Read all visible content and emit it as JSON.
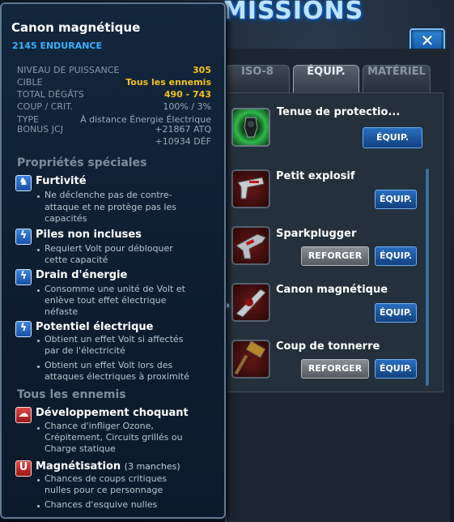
{
  "header": {
    "title": "MISSIONS",
    "close_label": "✕"
  },
  "tabs": [
    {
      "label": "ISO-8"
    },
    {
      "label": "ÉQUIP."
    },
    {
      "label": "MATÉRIEL"
    }
  ],
  "equipment": {
    "items": [
      {
        "name": "Tenue de protectio...",
        "equip_label": "ÉQUIP."
      },
      {
        "name": "Petit explosif",
        "equip_label": "ÉQUIP."
      },
      {
        "name": "Sparkplugger",
        "reforge_label": "REFORGER",
        "equip_label": "ÉQUIP."
      },
      {
        "name": "Canon magnétique",
        "equip_label": "ÉQUIP."
      },
      {
        "name": "Coup de tonnerre",
        "reforge_label": "REFORGER",
        "equip_label": "ÉQUIP."
      }
    ]
  },
  "tooltip": {
    "title": "Canon magnétique",
    "endurance": "2145 ENDURANCE",
    "stats": {
      "power_label": "NIVEAU DE PUISSANCE",
      "power_value": "305",
      "target_label": "CIBLE",
      "target_value": "Tous les ennemis",
      "damage_label": "TOTAL DÉGÂTS",
      "damage_value": "490 - 743",
      "crit_label": "COUP / CRIT.",
      "crit_value": "100% / 3%",
      "type_label": "TYPE",
      "type_value": "À distance Énergie Électrique",
      "bonus_label": "BONUS JCJ",
      "bonus_value_1": "+21867 ATQ",
      "bonus_value_2": "+10934 DÉF"
    },
    "special_header": "Propriétés spéciales",
    "properties": [
      {
        "title": "Furtivité",
        "icon": "stealth-icon",
        "desc": [
          "Ne déclenche pas de contre-",
          "attaque et ne protège pas les",
          "capacités"
        ]
      },
      {
        "title": "Piles non incluses",
        "icon": "lightning-icon",
        "desc": [
          "Requiert Volt pour débloquer",
          "cette capacité"
        ]
      },
      {
        "title": "Drain d'énergie",
        "icon": "lightning-icon",
        "desc": [
          "Consomme une unité de Volt et",
          "enlève tout effet électrique",
          "néfaste"
        ]
      },
      {
        "title": "Potentiel électrique",
        "icon": "lightning-icon",
        "desc": [
          "Obtient un effet Volt si affectés",
          "par de l'électricité"
        ],
        "desc2": [
          "Obtient un effet Volt lors des",
          "attaques électriques à proximité"
        ]
      }
    ],
    "enemies_header": "Tous les ennemis",
    "enemy_properties": [
      {
        "title": "Développement choquant",
        "icon": "shock-icon",
        "desc": [
          "Chance d'infliger Ozone,",
          "Crépitement, Circuits grillés ou",
          "Charge statique"
        ]
      },
      {
        "title": "Magnétisation",
        "note": "(3 manches)",
        "icon": "magnet-icon",
        "desc": [
          "Chances de coups critiques",
          "nulles pour ce personnage"
        ],
        "desc2": [
          "Chances d'esquive nulles"
        ]
      }
    ]
  },
  "colors": {
    "accent_blue": "#3ab0ff",
    "gold": "#f2c31c",
    "panel": "#13263c"
  }
}
